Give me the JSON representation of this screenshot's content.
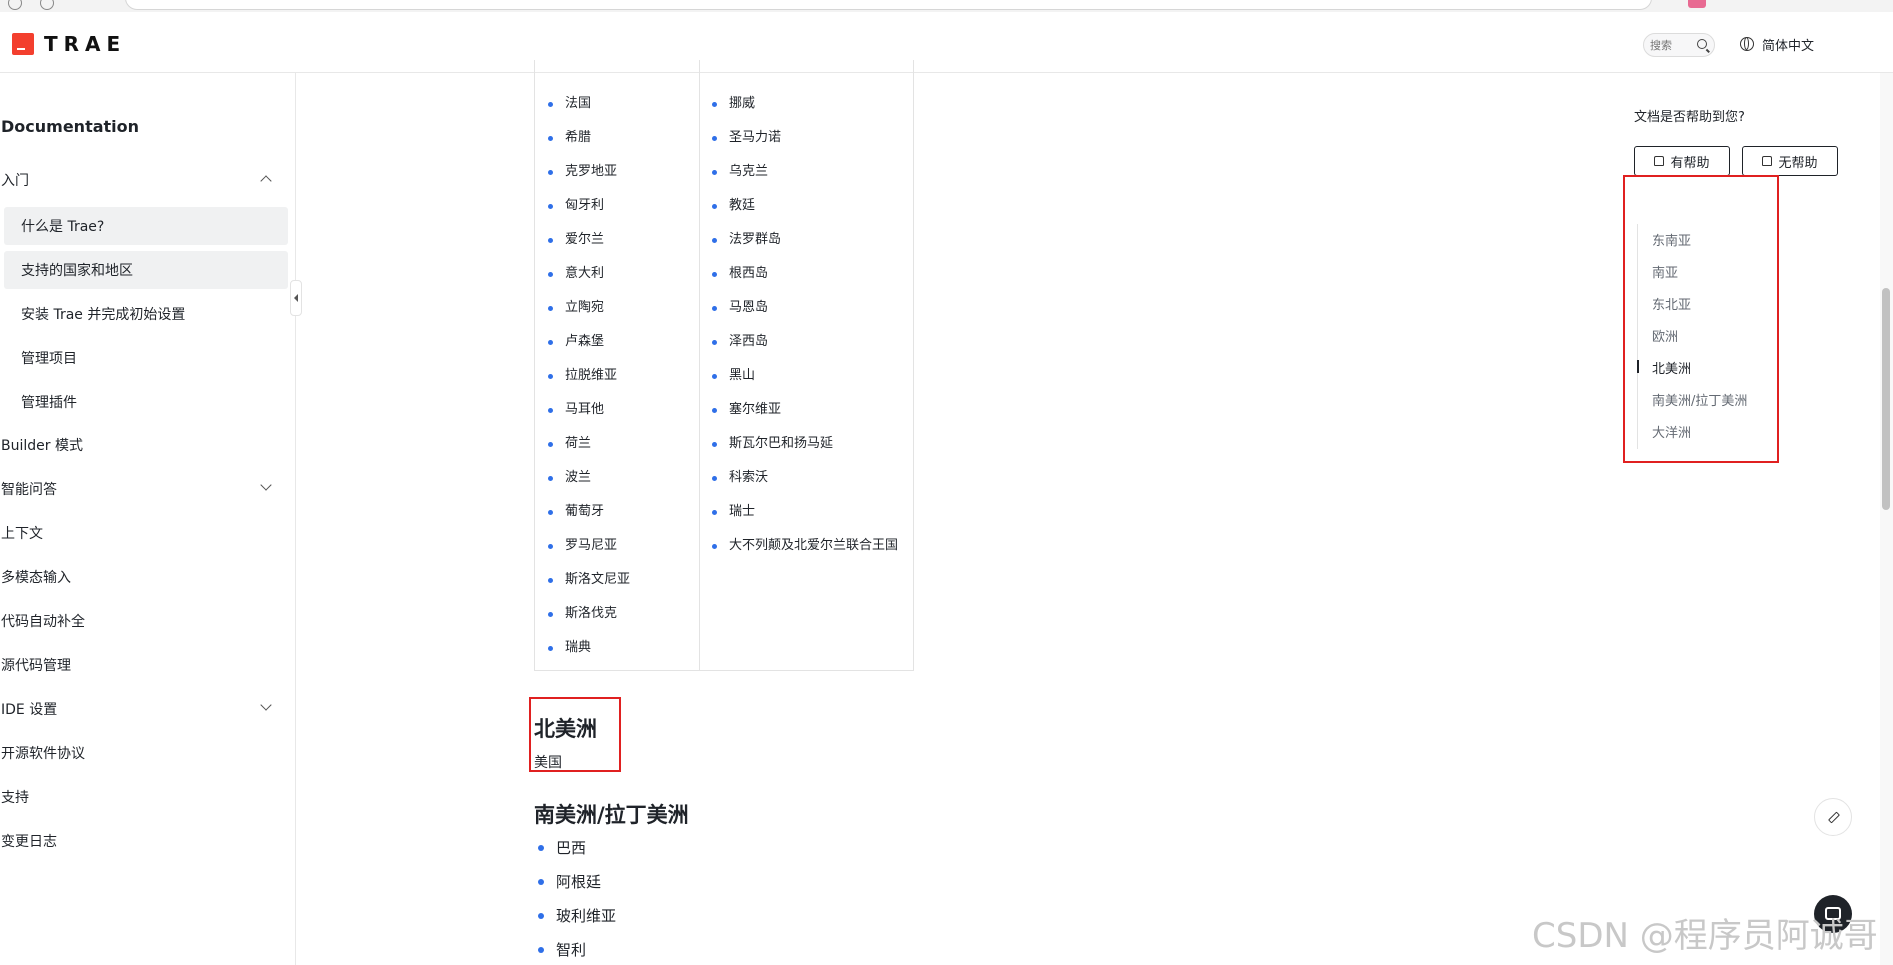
{
  "header": {
    "logo_text": "TRAE",
    "search_placeholder": "搜索",
    "language": "简体中文"
  },
  "sidebar": {
    "title": "Documentation",
    "items": [
      {
        "label": "入门"
      },
      {
        "label": "什么是 Trae?"
      },
      {
        "label": "支持的国家和地区"
      },
      {
        "label": "安装 Trae 并完成初始设置"
      },
      {
        "label": "管理项目"
      },
      {
        "label": "管理插件"
      },
      {
        "label": "Builder 模式"
      },
      {
        "label": "智能问答"
      },
      {
        "label": "上下文"
      },
      {
        "label": "多模态输入"
      },
      {
        "label": "代码自动补全"
      },
      {
        "label": "源代码管理"
      },
      {
        "label": "IDE 设置"
      },
      {
        "label": "开源软件协议"
      },
      {
        "label": "支持"
      },
      {
        "label": "变更日志"
      }
    ]
  },
  "europe_table": {
    "col1": [
      "法国",
      "希腊",
      "克罗地亚",
      "匈牙利",
      "爱尔兰",
      "意大利",
      "立陶宛",
      "卢森堡",
      "拉脱维亚",
      "马耳他",
      "荷兰",
      "波兰",
      "葡萄牙",
      "罗马尼亚",
      "斯洛文尼亚",
      "斯洛伐克",
      "瑞典"
    ],
    "col2": [
      "挪威",
      "圣马力诺",
      "乌克兰",
      "教廷",
      "法罗群岛",
      "根西岛",
      "马恩岛",
      "泽西岛",
      "黑山",
      "塞尔维亚",
      "斯瓦尔巴和扬马延",
      "科索沃",
      "瑞士",
      "大不列颠及北爱尔兰联合王国"
    ]
  },
  "north_america": {
    "heading": "北美洲",
    "text": "美国"
  },
  "south_america": {
    "heading": "南美洲/拉丁美洲",
    "items": [
      "巴西",
      "阿根廷",
      "玻利维亚",
      "智利"
    ]
  },
  "feedback": {
    "question": "文档是否帮助到您?",
    "helpful": "有帮助",
    "not_helpful": "无帮助"
  },
  "toc": {
    "items": [
      "东南亚",
      "南亚",
      "东北亚",
      "欧洲",
      "北美洲",
      "南美洲/拉丁美洲",
      "大洋洲"
    ],
    "active": "北美洲"
  },
  "watermark": "CSDN @程序员阿诚哥",
  "colors": {
    "accent": "#2f6fe8",
    "annotation_red": "#e02020",
    "brand": "#f33f2e"
  }
}
